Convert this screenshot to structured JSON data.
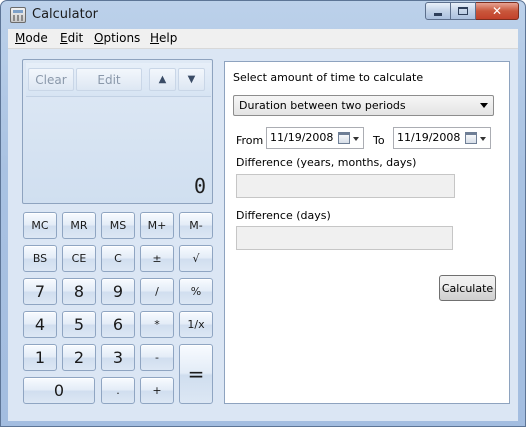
{
  "window": {
    "title": "Calculator"
  },
  "caption_buttons": {
    "close_glyph": "✕"
  },
  "menu": [
    {
      "label": "Mode",
      "accel": "M",
      "rest": "ode"
    },
    {
      "label": "Edit",
      "accel": "E",
      "rest": "dit"
    },
    {
      "label": "Options",
      "accel": "O",
      "rest": "ptions"
    },
    {
      "label": "Help",
      "accel": "H",
      "rest": "elp"
    }
  ],
  "calculator": {
    "history": {
      "clear": "Clear",
      "edit": "Edit",
      "up": "▲",
      "down": "▼"
    },
    "display_value": "0",
    "keys": {
      "mc": "MC",
      "mr": "MR",
      "ms": "MS",
      "mplus": "M+",
      "mminus": "M-",
      "bs": "BS",
      "ce": "CE",
      "c": "C",
      "plusminus": "±",
      "sqrt": "√",
      "k7": "7",
      "k8": "8",
      "k9": "9",
      "div": "/",
      "pct": "%",
      "k4": "4",
      "k5": "5",
      "k6": "6",
      "mul": "*",
      "recip": "1/x",
      "k1": "1",
      "k2": "2",
      "k3": "3",
      "sub": "-",
      "eq": "=",
      "k0": "0",
      "dot": ".",
      "add": "+"
    }
  },
  "date_panel": {
    "heading": "Select amount of time to calculate",
    "mode_selected": "Duration between two periods",
    "from_label": "From",
    "from_value": "11/19/2008",
    "to_label": "To",
    "to_value": "11/19/2008",
    "diff_ymd_label": "Difference (years, months, days)",
    "diff_ymd_value": "",
    "diff_days_label": "Difference (days)",
    "diff_days_value": "",
    "calculate_label": "Calculate"
  }
}
